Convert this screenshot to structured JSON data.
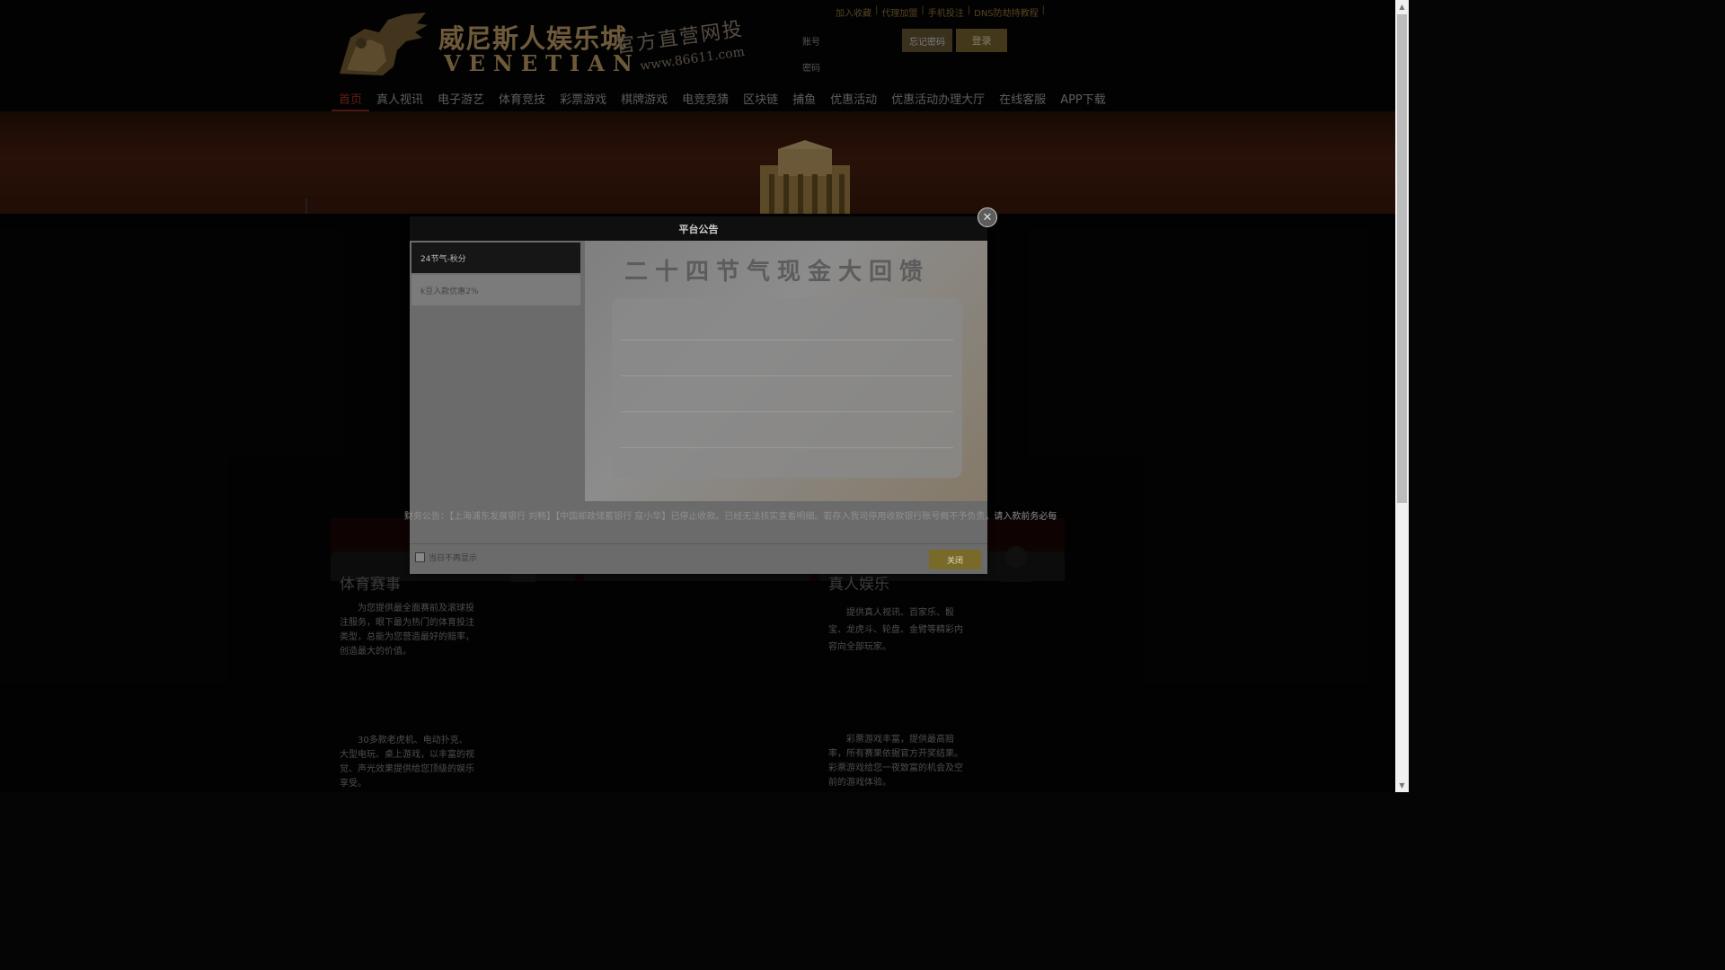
{
  "header": {
    "brand_cn": "威尼斯人娱乐城",
    "brand_en": "VENETIAN",
    "slogan": "官方直营网投",
    "url": "www.86611.com",
    "top_links": [
      "加入收藏",
      "代理加盟",
      "手机投注",
      "DNS防劫持教程"
    ],
    "login": {
      "account_label": "账号",
      "password_label": "密码",
      "forgot_label": "忘记密码",
      "login_label": "登录"
    }
  },
  "nav": {
    "items": [
      "首页",
      "真人视讯",
      "电子游艺",
      "体育竞技",
      "彩票游戏",
      "棋牌游戏",
      "电竞竞猜",
      "区块链",
      "捕鱼",
      "优惠活动",
      "优惠活动办理大厅",
      "在线客服",
      "APP下载"
    ],
    "active_index": 0
  },
  "modal": {
    "title": "平台公告",
    "tabs": [
      "24节气-秋分",
      "k豆入款优惠2%"
    ],
    "active_tab": 0,
    "image_headline": "二十四节气现金大回馈",
    "finance_notice": "财务公告：【上海浦东发展银行 刘畅】【中国邮政储蓄银行 寇小华】已停止收款。已经无法核实查看明细。若存入我司停用收款银行账号概不予负责。请入款前务必每",
    "dont_show_label": "当日不再显示",
    "close_label": "关闭"
  },
  "sections": {
    "left_title": "体育赛事",
    "right_title": "真人娱乐",
    "sports_desc": "为您提供最全面赛前及滚球投注服务，眼下最为热门的体育投注类型，总能为您营造最好的赔率，创造最大的价值。",
    "live_desc": "提供真人视讯、百家乐、骰宝、龙虎斗、轮盘、金臂等精彩内容向全部玩家。",
    "slots_desc": "30多款老虎机、电动扑克、大型电玩、桌上游戏，以丰富的视觉、声光效果提供给您顶级的娱乐享受。",
    "lottery_desc": "彩票游戏丰富，提供最高赔率，所有赛果依据官方开奖结果。彩票游戏给您一夜致富的机会及空前的游戏体验。"
  },
  "colors": {
    "accent_gold": "#c8a56a",
    "nav_active": "#b3342a",
    "button_gold": "#7a6a2a"
  }
}
